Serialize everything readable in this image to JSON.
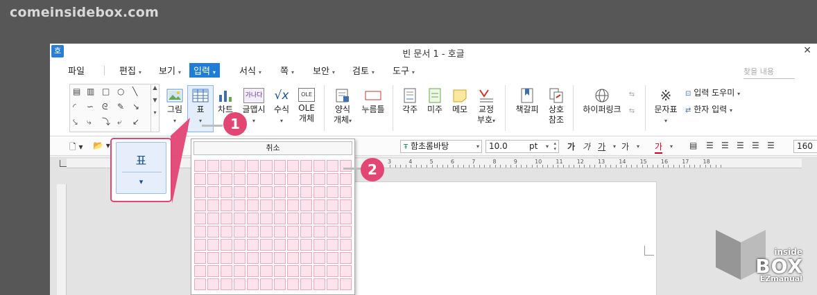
{
  "site_watermark": "comeinsidebox.com",
  "window": {
    "app_icon": "호",
    "title": "빈 문서 1 - 호글"
  },
  "menu": {
    "items": [
      {
        "label": "파일",
        "caret": ""
      },
      {
        "label": "편집",
        "caret": "▾"
      },
      {
        "label": "보기",
        "caret": "▾"
      },
      {
        "label": "입력",
        "caret": "▾",
        "active": true
      },
      {
        "label": "서식",
        "caret": "▾"
      },
      {
        "label": "쪽",
        "caret": "▾"
      },
      {
        "label": "보안",
        "caret": "▾"
      },
      {
        "label": "검토",
        "caret": "▾"
      },
      {
        "label": "도구",
        "caret": "▾"
      }
    ],
    "search_placeholder": "찾을 내용"
  },
  "ribbon": {
    "picture": "그림",
    "table": "표",
    "chart": "차트",
    "textart": "글맵시",
    "equation": "수식",
    "ole_line1": "OLE",
    "ole_line2": "개체",
    "form_line1": "양식",
    "form_line2": "개체",
    "pushbutton": "누름틀",
    "footnote": "각주",
    "endnote": "미주",
    "memo": "메모",
    "proof_line1": "교정",
    "proof_line2": "부호",
    "bookmark": "책갈피",
    "crossref_line1": "상호",
    "crossref_line2": "참조",
    "hyperlink": "하이퍼링크",
    "symbol": "문자표",
    "input_helper": "입력 도우미",
    "hanja_input": "한자 입력",
    "equation_icon": "√x",
    "ole_icon": "OLE",
    "textart_icon": "가나다"
  },
  "format_bar": {
    "font_name": "함초롬바탕",
    "font_size": "10.0",
    "size_unit": "pt",
    "bold": "가",
    "italic": "가",
    "underline": "가",
    "strike": "가",
    "color": "가",
    "zoom": "160"
  },
  "ruler_numbers": [
    "3",
    "4",
    "5",
    "6",
    "7",
    "8",
    "9",
    "10",
    "11",
    "12",
    "13",
    "14",
    "15",
    "16",
    "17",
    "18"
  ],
  "table_popup": {
    "cancel_label": "취소",
    "rows": 10,
    "cols": 12
  },
  "callout": {
    "label": "표",
    "caret": "▾"
  },
  "markers": {
    "first": "1",
    "second": "2"
  },
  "logo": {
    "small": "inside",
    "big": "BOX",
    "sub": "EZmanual"
  },
  "colors": {
    "accent": "#1e7dd6",
    "highlight": "#e24673",
    "grid_pink": "#fde4ec"
  }
}
